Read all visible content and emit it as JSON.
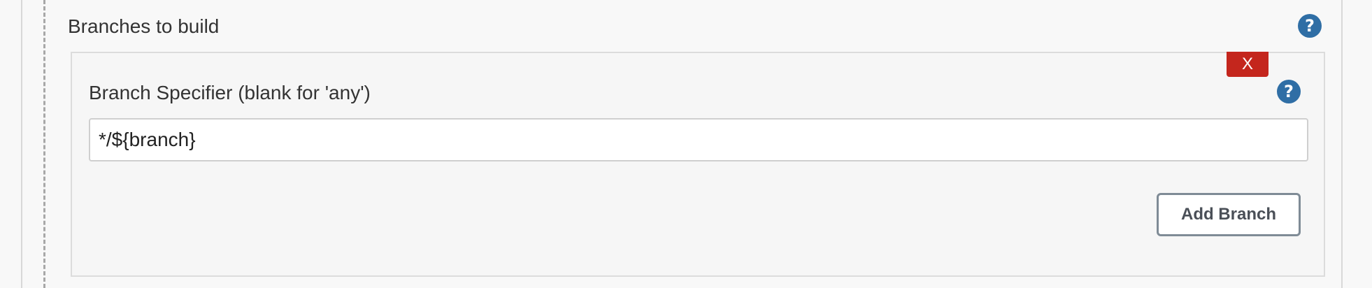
{
  "section": {
    "title": "Branches to build",
    "help_glyph": "?"
  },
  "branch_entry": {
    "delete_label": "X",
    "label": "Branch Specifier (blank for 'any')",
    "help_glyph": "?",
    "value": "*/${branch}"
  },
  "actions": {
    "add_branch_label": "Add Branch"
  },
  "colors": {
    "help_icon": "#2f6ea5",
    "delete_button": "#c4261d",
    "button_border": "#7f8b96"
  },
  "icons": {
    "help": "help-icon",
    "delete": "close-icon"
  }
}
